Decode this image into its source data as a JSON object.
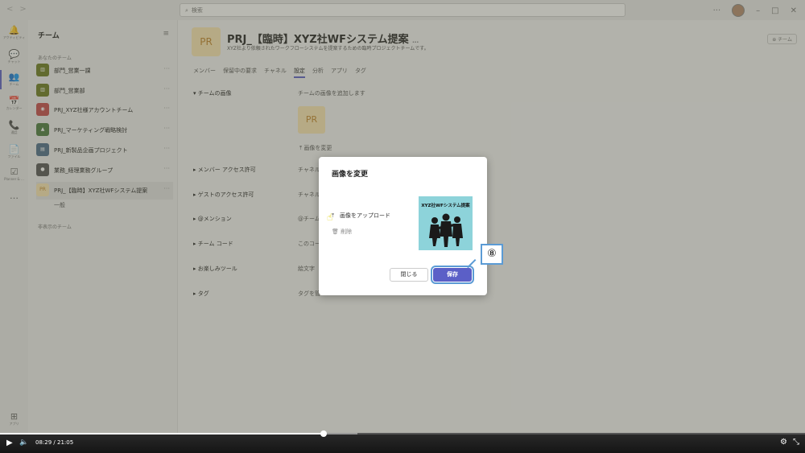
{
  "search": {
    "placeholder": "検索"
  },
  "rail": {
    "items": [
      {
        "icon": "🔔",
        "label": "アクティビティ"
      },
      {
        "icon": "💬",
        "label": "チャット"
      },
      {
        "icon": "👥",
        "label": "チーム"
      },
      {
        "icon": "📅",
        "label": "カレンダー"
      },
      {
        "icon": "📞",
        "label": "通話"
      },
      {
        "icon": "📄",
        "label": "ファイル"
      },
      {
        "icon": "☑",
        "label": "Planner & …"
      }
    ],
    "more": "…",
    "apps": "アプリ"
  },
  "teams": {
    "title": "チーム",
    "section_yours": "あなたのチーム",
    "items": [
      {
        "name": "部門_営業一課",
        "color": "#6b7b1f"
      },
      {
        "name": "部門_営業部",
        "color": "#6b7b1f"
      },
      {
        "name": "PRJ_XYZ社様アカウントチーム",
        "color": "#c44b4b"
      },
      {
        "name": "PRJ_マーケティング戦略検討",
        "color": "#4a7a3f"
      },
      {
        "name": "PRJ_新製品企画プロジェクト",
        "color": "#4d6d8a"
      },
      {
        "name": "業務_経理業務グループ",
        "color": "#555555"
      },
      {
        "name": "PRJ_【臨時】XYZ社WFシステム提案",
        "color": "#fbe7b4",
        "initials": "PR"
      }
    ],
    "channel": "一般",
    "section_hidden": "非表示のチーム"
  },
  "main": {
    "initials": "PR",
    "title": "PRJ_【臨時】XYZ社WFシステム提案",
    "title_more": "…",
    "description": "XYZ社より依頼されたワークフローシステムを提案するための臨時プロジェクトチームです。",
    "team_button": "チーム",
    "tabs": [
      "メンバー",
      "保留中の要求",
      "チャネル",
      "設定",
      "分析",
      "アプリ",
      "タグ"
    ],
    "settings": [
      {
        "label": "チームの画像",
        "value": "チームの画像を追加します"
      },
      {
        "label": "メンバー アクセス許可",
        "value": "チャネル"
      },
      {
        "label": "ゲストのアクセス許可",
        "value": "チャネル"
      },
      {
        "label": "@メンション",
        "value": "@チーム"
      },
      {
        "label": "チーム コード",
        "value": "このコー"
      },
      {
        "label": "お楽しみツール",
        "value": "絵文字"
      },
      {
        "label": "タグ",
        "value": "タグを管"
      }
    ],
    "change_image": "画像を変更"
  },
  "dialog": {
    "title": "画像を変更",
    "upload": "画像をアップロード",
    "delete": "削除",
    "preview_caption": "XYZ社WFシステム提案",
    "close": "閉じる",
    "save": "保存"
  },
  "callout": "⑧",
  "video": {
    "current": "08:29",
    "separator": "/",
    "duration": "21:05",
    "progress": 0.402
  }
}
